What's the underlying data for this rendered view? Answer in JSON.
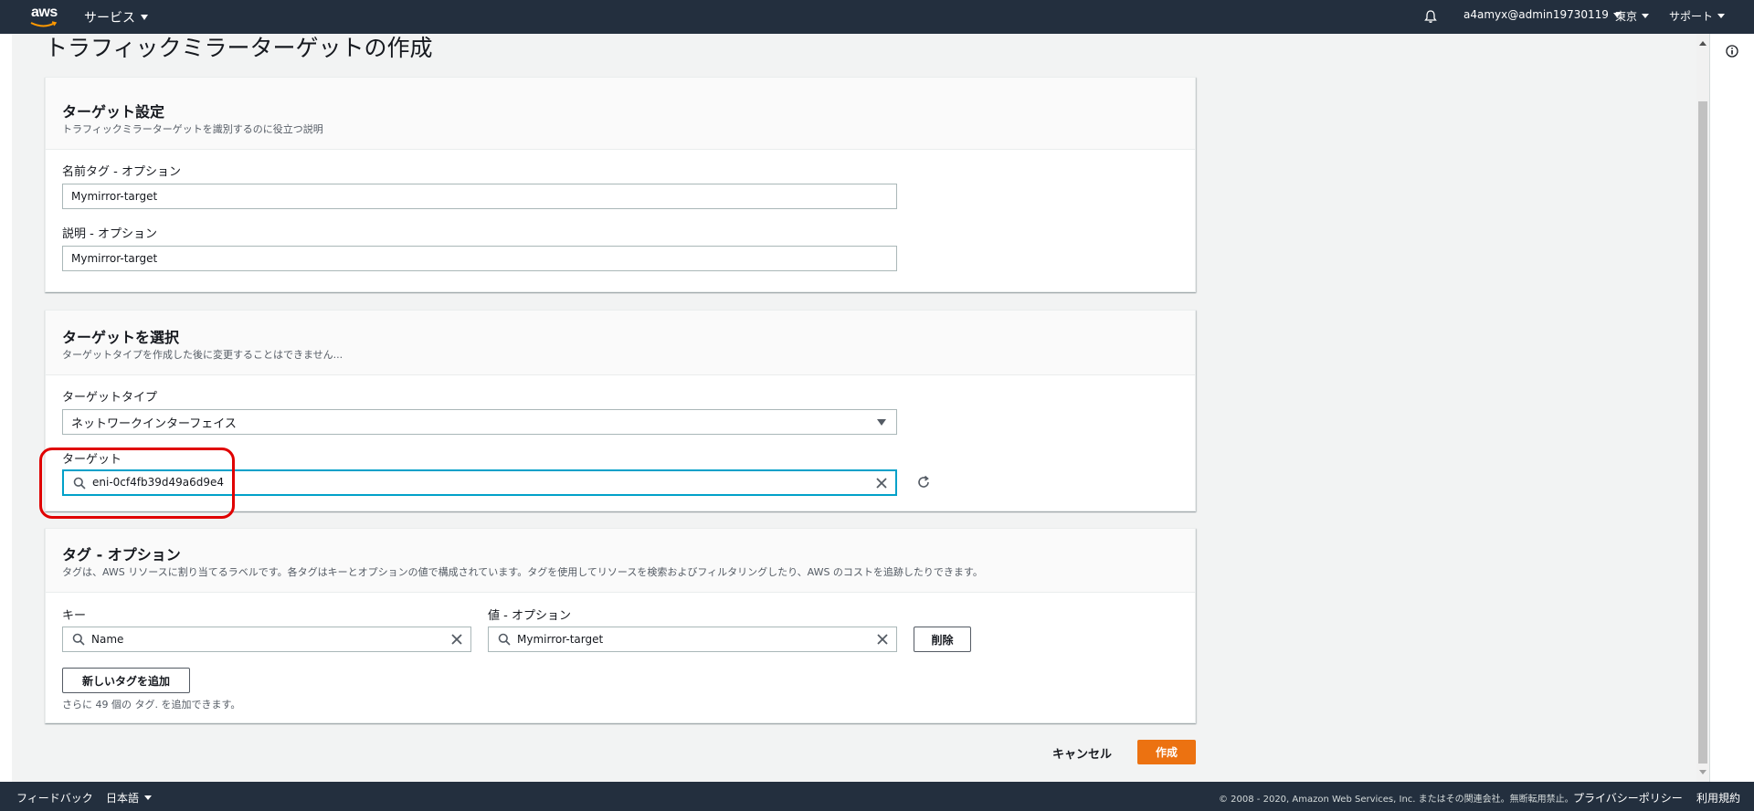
{
  "nav": {
    "logo": "aws",
    "services": "サービス",
    "account": "a4amyx@admin19730119",
    "region": "東京",
    "support": "サポート"
  },
  "page": {
    "title": "トラフィックミラーターゲットの作成"
  },
  "target_settings": {
    "title": "ターゲット設定",
    "description": "トラフィックミラーターゲットを識別するのに役立つ説明",
    "name_label": "名前タグ - オプション",
    "name_value": "Mymirror-target",
    "desc_label": "説明 - オプション",
    "desc_value": "Mymirror-target"
  },
  "select_target": {
    "title": "ターゲットを選択",
    "description": "ターゲットタイプを作成した後に変更することはできません...",
    "type_label": "ターゲットタイプ",
    "type_value": "ネットワークインターフェイス",
    "target_label": "ターゲット",
    "target_value": "eni-0cf4fb39d49a6d9e4"
  },
  "tags": {
    "title": "タグ - オプション",
    "description": "タグは、AWS リソースに割り当てるラベルです。各タグはキーとオプションの値で構成されています。タグを使用してリソースを検索およびフィルタリングしたり、AWS のコストを追跡したりできます。",
    "key_label": "キー",
    "value_label": "値 - オプション",
    "key_value": "Name",
    "value_value": "Mymirror-target",
    "delete_button": "削除",
    "add_button": "新しいタグを追加",
    "hint": "さらに 49 個の タグ. を追加できます。"
  },
  "actions": {
    "cancel": "キャンセル",
    "create": "作成"
  },
  "footer": {
    "feedback": "フィードバック",
    "language": "日本語",
    "copyright": "© 2008 - 2020, Amazon Web Services, Inc. またはその関連会社。無断転用禁止。",
    "privacy": "プライバシーポリシー",
    "terms": "利用規約"
  },
  "colors": {
    "nav_bg": "#232f3e",
    "primary": "#ec7211",
    "focus": "#00a1c9",
    "highlight": "#e00000"
  }
}
